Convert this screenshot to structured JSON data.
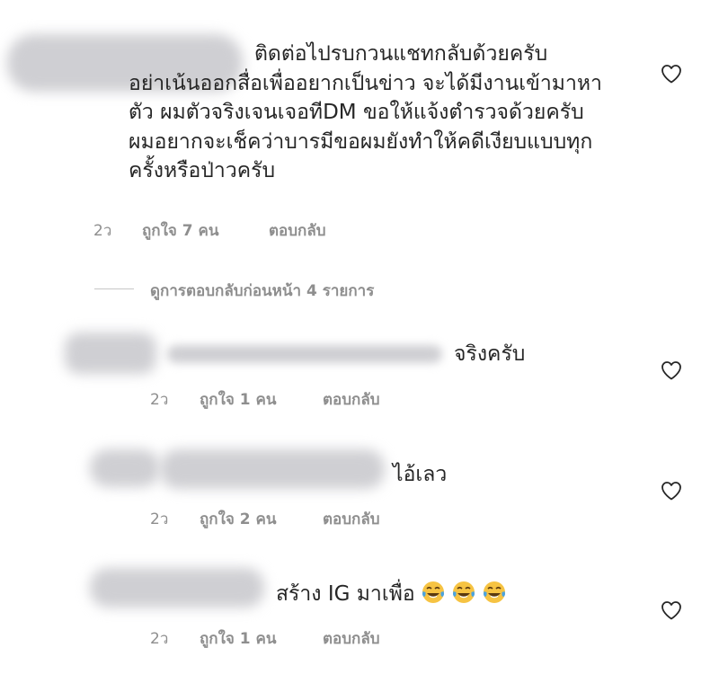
{
  "comments": [
    {
      "lines": [
        "ติดต่อไปรบกวนแชทกลับด้วยครับ",
        "อย่าเน้นออกสื่อเพื่ออยากเป็นข่าว จะได้มีงานเข้ามาหา",
        "ตัว ผมตัวจริงเจนเจอทีDM ขอให้แจ้งตำรวจด้วยครับ",
        "ผมอยากจะเช็คว่าบารมีขอผมยังทำให้คดีเงียบแบบทุก",
        "ครั้งหรือป่าวครับ"
      ],
      "time": "2ว",
      "likes": "ถูกใจ 7 คน",
      "reply": "ตอบกลับ"
    },
    {
      "lines": [
        "จริงครับ"
      ],
      "time": "2ว",
      "likes": "ถูกใจ 1 คน",
      "reply": "ตอบกลับ"
    },
    {
      "lines": [
        "ไอ้เลว"
      ],
      "time": "2ว",
      "likes": "ถูกใจ 2 คน",
      "reply": "ตอบกลับ"
    },
    {
      "lines": [
        "สร้าง IG มาเพื่อ"
      ],
      "emoji": [
        "face-with-tears-of-joy-icon",
        "face-with-tears-of-joy-icon",
        "face-with-tears-of-joy-icon"
      ],
      "time": "2ว",
      "likes": "ถูกใจ 1 คน",
      "reply": "ตอบกลับ"
    }
  ],
  "view_replies": "ดูการตอบกลับก่อนหน้า 4 รายการ",
  "colors": {
    "text": "#262626",
    "secondary": "#8e8e8e",
    "divider": "#c7c7c7",
    "redaction": "#cfcfd3"
  }
}
